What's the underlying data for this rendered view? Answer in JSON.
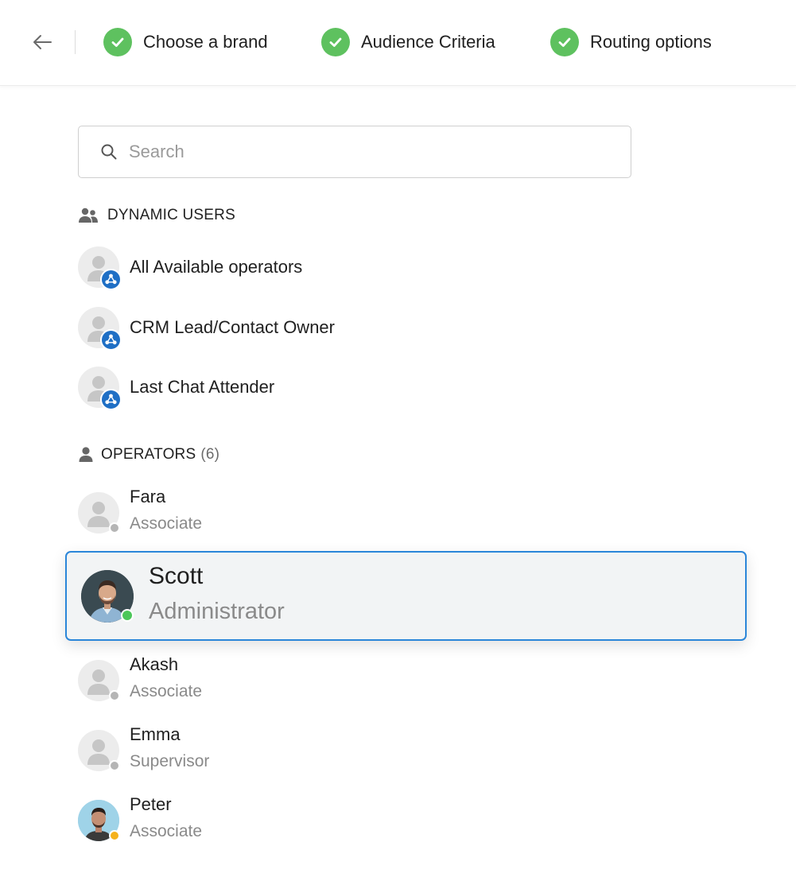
{
  "header": {
    "steps": [
      {
        "label": "Choose a brand",
        "done": true
      },
      {
        "label": "Audience Criteria",
        "done": true
      },
      {
        "label": "Routing options",
        "done": true
      }
    ]
  },
  "search": {
    "placeholder": "Search",
    "value": ""
  },
  "dynamic_users": {
    "title": "DYNAMIC USERS",
    "items": [
      {
        "label": "All Available operators"
      },
      {
        "label": "CRM Lead/Contact Owner"
      },
      {
        "label": "Last Chat Attender"
      }
    ]
  },
  "operators": {
    "title": "OPERATORS",
    "count": "(6)",
    "items": [
      {
        "name": "Fara",
        "role": "Associate",
        "status": "offline"
      },
      {
        "name": "Scott",
        "role": "Administrator",
        "status": "online",
        "selected": true
      },
      {
        "name": "Akash",
        "role": "Associate",
        "status": "offline"
      },
      {
        "name": "Emma",
        "role": "Supervisor",
        "status": "offline"
      },
      {
        "name": "Peter",
        "role": "Associate",
        "status": "away"
      }
    ]
  },
  "colors": {
    "check": "#5ec15f",
    "selected_border": "#2b86d9",
    "dynamic_badge": "#1f6fc5",
    "status_online": "#4cc75a",
    "status_offline": "#b5b5b5",
    "status_away": "#f5b21c"
  },
  "icons": {
    "back": "arrow-left-icon",
    "step_done": "check-circle-icon",
    "search": "search-icon",
    "dynamic_section": "users-group-icon",
    "operators_section": "user-icon",
    "dynamic_badge": "routing-icon"
  }
}
